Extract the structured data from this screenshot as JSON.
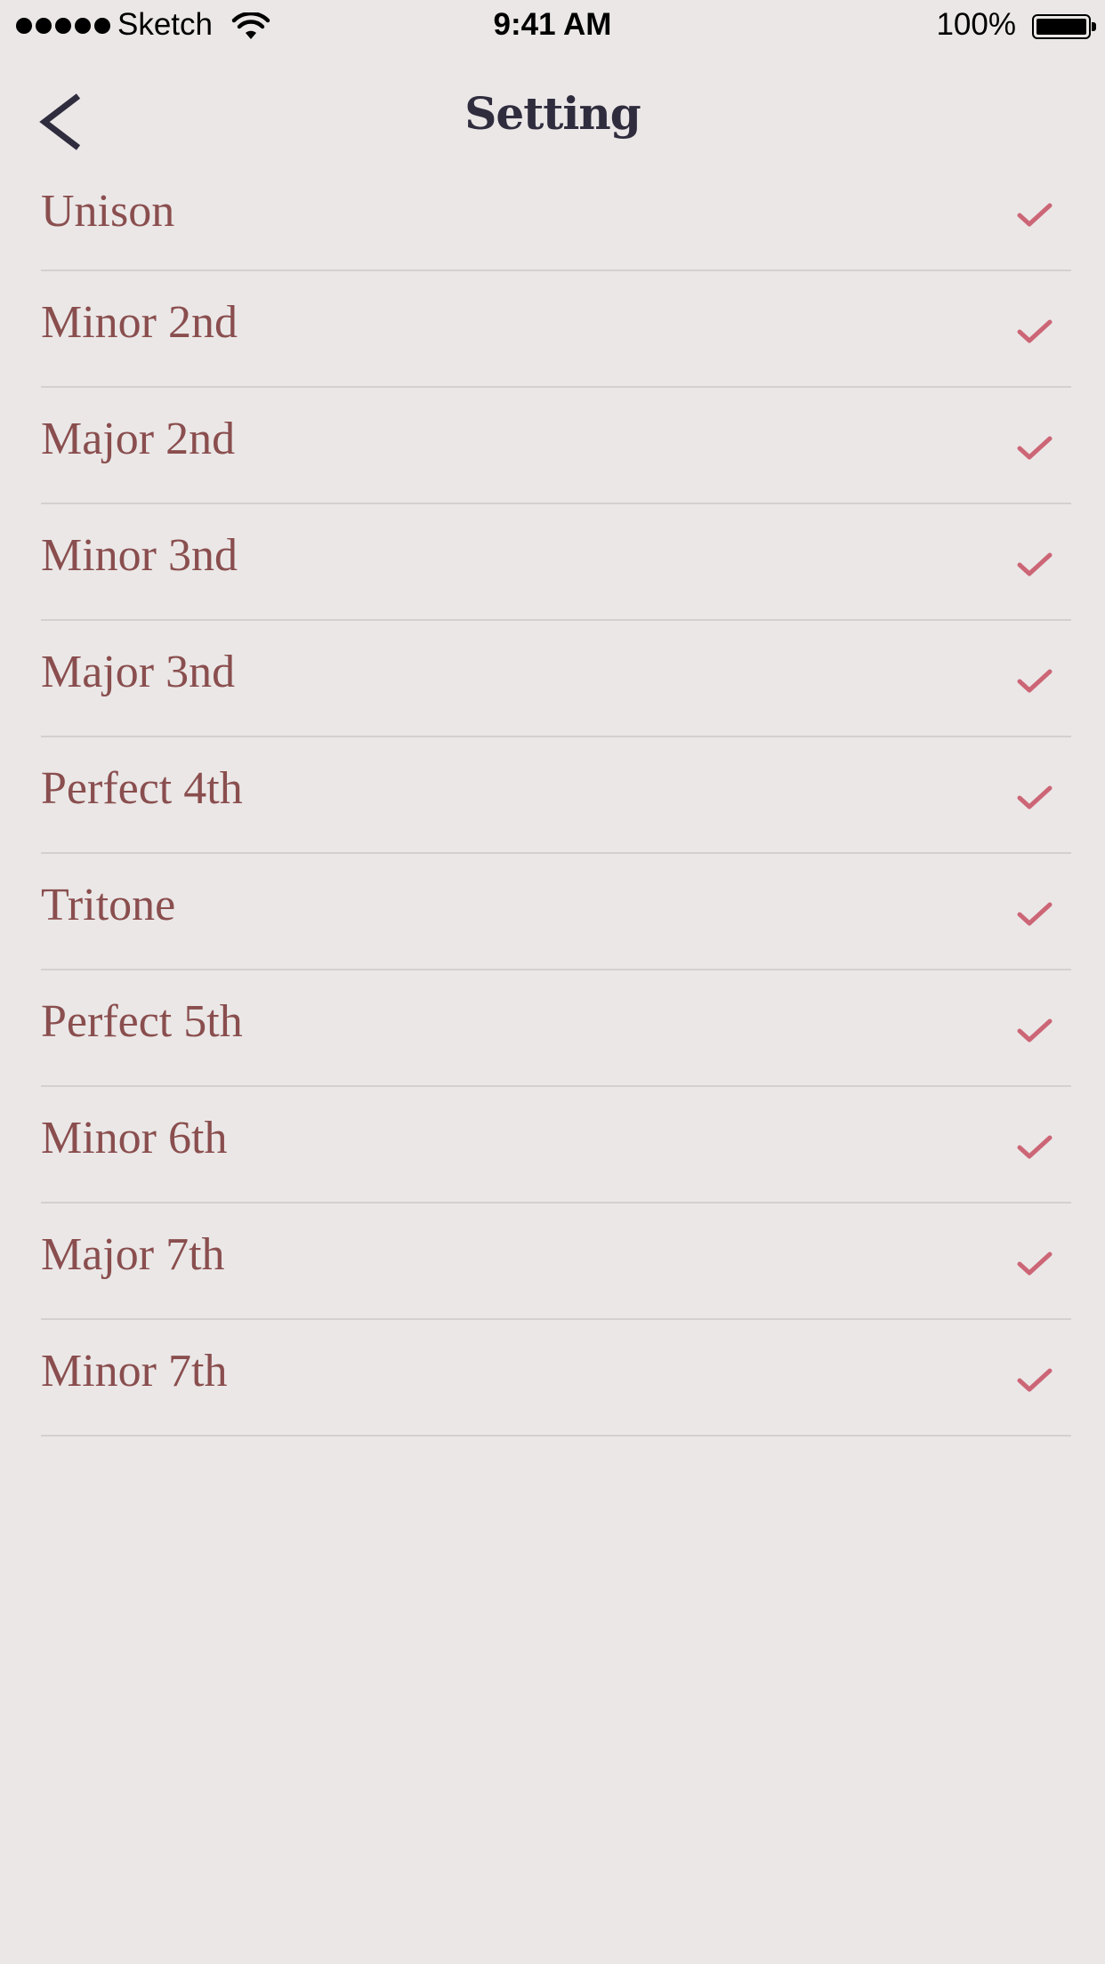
{
  "status_bar": {
    "carrier": "Sketch",
    "time": "9:41 AM",
    "battery": "100%"
  },
  "nav": {
    "title": "Setting",
    "back_icon": "chevron-left-icon"
  },
  "colors": {
    "background": "#ebe7e7",
    "title": "#2f2c3d",
    "item_text": "#8a4e4e",
    "check": "#cc6676",
    "divider": "#d4d0d0"
  },
  "intervals": [
    {
      "label": "Unison",
      "checked": true
    },
    {
      "label": "Minor 2nd",
      "checked": true
    },
    {
      "label": "Major 2nd",
      "checked": true
    },
    {
      "label": "Minor 3nd",
      "checked": true
    },
    {
      "label": "Major 3nd",
      "checked": true
    },
    {
      "label": "Perfect 4th",
      "checked": true
    },
    {
      "label": "Tritone",
      "checked": true
    },
    {
      "label": "Perfect 5th",
      "checked": true
    },
    {
      "label": "Minor 6th",
      "checked": true
    },
    {
      "label": "Major 7th",
      "checked": true
    },
    {
      "label": "Minor 7th",
      "checked": true
    }
  ]
}
